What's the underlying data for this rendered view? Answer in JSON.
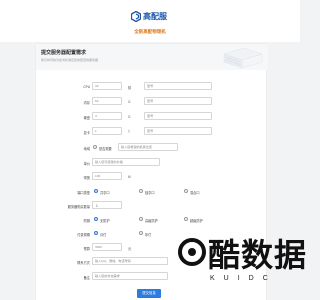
{
  "header": {
    "brand": "高配服",
    "subtitle": "全新高配物理机",
    "accent_color": "#1a56a8",
    "subtitle_color": "#e07b1a"
  },
  "card": {
    "title": "提交服务器配置需求",
    "description": "我们将尽快为您寻找满足您的配置的服务器"
  },
  "form": {
    "cpu": {
      "label": "CPU",
      "value": "32",
      "unit": "核",
      "note_placeholder": "型号"
    },
    "memory": {
      "label": "内存",
      "value": "64",
      "unit": "G",
      "note_placeholder": "型号"
    },
    "disk": {
      "label": "硬盘",
      "value": "4",
      "unit": "G",
      "note_placeholder": "型号"
    },
    "gpu": {
      "label": "显卡",
      "value": "1",
      "unit": "T",
      "note_placeholder": "型号"
    },
    "region": {
      "label": "地域",
      "selected": "是否需要",
      "value_placeholder": "输入您希望的机房位置"
    },
    "price": {
      "label": "单价",
      "placeholder": "输入您可接受的价格"
    },
    "bandwidth": {
      "label": "带宽",
      "value": "100",
      "unit": "M"
    },
    "port_type": {
      "label": "端口类型",
      "options": [
        "共享口",
        "独享口",
        "混合口"
      ],
      "selected_index": 0
    },
    "count": {
      "label": "服务器购买数量",
      "value": "1"
    },
    "protection": {
      "label": "防御",
      "options": [
        "无防护",
        "高级防护",
        "超级防护"
      ],
      "selected_index": 0
    },
    "duration": {
      "label": "付费周期",
      "options": [
        "月付",
        "年付"
      ],
      "selected_index": 0
    },
    "budget": {
      "label": "预算",
      "value": "3000",
      "unit": "元"
    },
    "contact": {
      "label": "联系方式",
      "placeholder": "输入QQ、微信、电话号码"
    },
    "remark": {
      "label": "备注",
      "placeholder": "输入您的补充需求"
    }
  },
  "submit_label": "提交信息",
  "watermark": {
    "main": "酷数据",
    "sub": "KUIDC"
  }
}
